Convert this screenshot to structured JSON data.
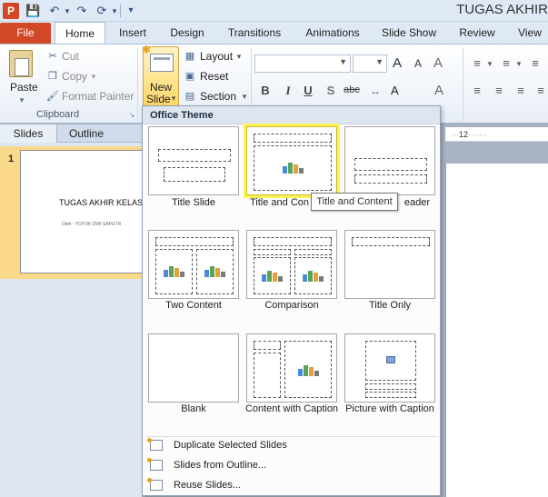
{
  "window": {
    "title": "TUGAS AKHIR"
  },
  "quick_access": {
    "app_icon_letter": "P",
    "icons": [
      "save-icon",
      "undo-icon",
      "redo-icon",
      "repeat-icon",
      "customize-icon"
    ]
  },
  "tabs": [
    {
      "label": "File",
      "key": "file"
    },
    {
      "label": "Home",
      "key": "home",
      "active": true
    },
    {
      "label": "Insert",
      "key": "insert"
    },
    {
      "label": "Design",
      "key": "design"
    },
    {
      "label": "Transitions",
      "key": "transitions"
    },
    {
      "label": "Animations",
      "key": "animations"
    },
    {
      "label": "Slide Show",
      "key": "slide-show"
    },
    {
      "label": "Review",
      "key": "review"
    },
    {
      "label": "View",
      "key": "view"
    }
  ],
  "ribbon": {
    "clipboard": {
      "paste": "Paste",
      "cut": "Cut",
      "copy": "Copy",
      "format_painter": "Format Painter",
      "group_label": "Clipboard"
    },
    "slides": {
      "new_slide_line1": "New",
      "new_slide_line2": "Slide",
      "layout": "Layout",
      "reset": "Reset",
      "section": "Section"
    },
    "font": {
      "grow": "A",
      "shrink": "A",
      "bold": "B",
      "italic": "I",
      "underline": "U",
      "shadow": "S",
      "strike": "abc"
    }
  },
  "slides_pane": {
    "tabs": [
      "Slides",
      "Outline"
    ],
    "slide_number": "1",
    "thumb_title": "TUGAS AKHIR KELAS",
    "thumb_subtitle": "Oleh : YOYOK DWI SAPUTR"
  },
  "ruler": {
    "label": "12"
  },
  "menu": {
    "header": "Office Theme",
    "layouts": [
      {
        "label": "Title Slide",
        "key": "title-slide"
      },
      {
        "label": "Title and Content",
        "key": "title-and-content",
        "selected": true
      },
      {
        "label": "Section Header",
        "key": "section-header"
      },
      {
        "label": "Two Content",
        "key": "two-content"
      },
      {
        "label": "Comparison",
        "key": "comparison"
      },
      {
        "label": "Title Only",
        "key": "title-only"
      },
      {
        "label": "Blank",
        "key": "blank"
      },
      {
        "label": "Content with Caption",
        "key": "content-with-caption"
      },
      {
        "label": "Picture with Caption",
        "key": "picture-with-caption"
      }
    ],
    "tile_labels_visible": {
      "title_and_content": "Title and Con",
      "section_header": "eader"
    },
    "actions": [
      {
        "label": "Duplicate Selected Slides",
        "key": "duplicate"
      },
      {
        "label": "Slides from Outline...",
        "key": "from-outline"
      },
      {
        "label": "Reuse Slides...",
        "key": "reuse"
      }
    ],
    "tooltip": "Title and Content"
  },
  "colors": {
    "file_tab": "#d24726",
    "selection_highlight": "#fcf251",
    "new_slide_active": "#ffd768",
    "slide_selected": "#fbd98a"
  }
}
